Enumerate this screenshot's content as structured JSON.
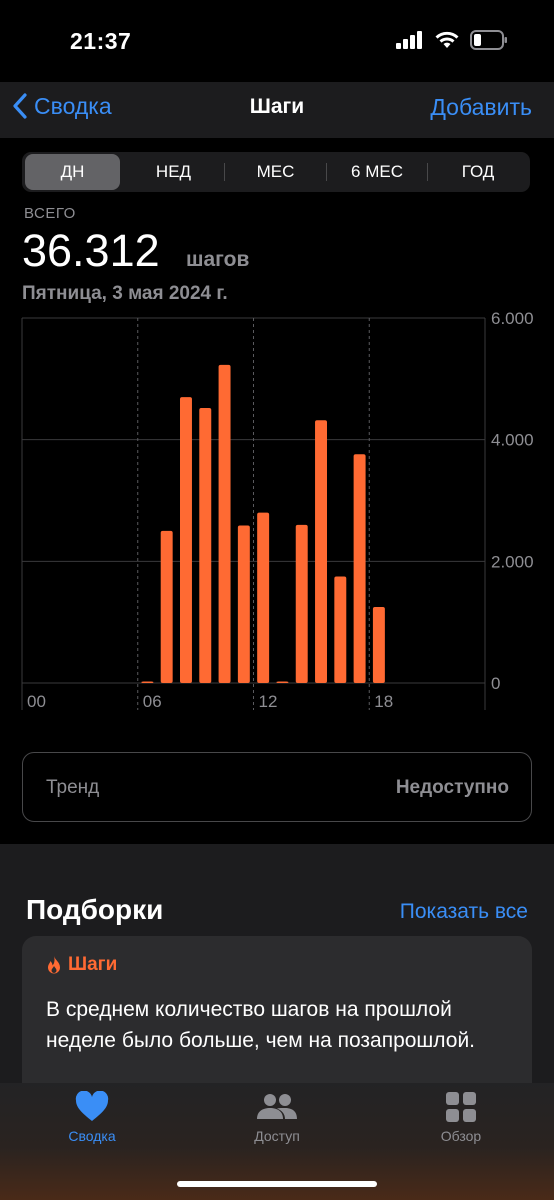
{
  "status_bar": {
    "time": "21:37"
  },
  "nav": {
    "back_label": "Сводка",
    "title": "Шаги",
    "action_label": "Добавить"
  },
  "segments": [
    {
      "label": "ДН",
      "active": true
    },
    {
      "label": "НЕД",
      "active": false
    },
    {
      "label": "МЕС",
      "active": false
    },
    {
      "label": "6 МЕС",
      "active": false
    },
    {
      "label": "ГОД",
      "active": false
    }
  ],
  "summary": {
    "label": "ВСЕГО",
    "value": "36.312",
    "unit": "шагов",
    "date": "Пятница, 3 мая 2024 г."
  },
  "chart_data": {
    "type": "bar",
    "x_tick_labels": [
      "00",
      "06",
      "12",
      "18"
    ],
    "y_tick_labels": [
      "6.000",
      "4.000",
      "2.000",
      "0"
    ],
    "ylim": [
      0,
      6000
    ],
    "hours": [
      6,
      7,
      8,
      9,
      10,
      11,
      12,
      13,
      14,
      15,
      16,
      17,
      18
    ],
    "values": [
      20,
      2500,
      4700,
      4520,
      5230,
      2590,
      2800,
      20,
      2600,
      4320,
      1750,
      3760,
      1250
    ],
    "bar_color": "#ff6a33",
    "grid": true
  },
  "trend": {
    "label": "Тренд",
    "value": "Недоступно"
  },
  "highlights": {
    "title": "Подборки",
    "show_all": "Показать все",
    "card": {
      "tag": "Шаги",
      "text": "В среднем количество шагов на прошлой неделе было больше, чем на позапрошлой."
    }
  },
  "tabs": [
    {
      "label": "Сводка",
      "icon": "heart-icon",
      "active": true
    },
    {
      "label": "Доступ",
      "icon": "people-icon",
      "active": false
    },
    {
      "label": "Обзор",
      "icon": "grid-icon",
      "active": false
    }
  ],
  "colors": {
    "accent": "#3a8ef6",
    "steps": "#ff6a33"
  }
}
